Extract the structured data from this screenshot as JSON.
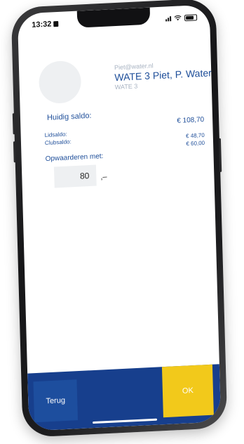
{
  "status_bar": {
    "time": "13:32"
  },
  "user": {
    "email": "Piet@water.nl",
    "name": "WATE 3 Piet, P. Water",
    "code": "WATE 3"
  },
  "saldo": {
    "title": "Huidig saldo:",
    "total": "€ 108,70",
    "lidsaldo_label": "Lidsaldo:",
    "lidsaldo_value": "€ 48,70",
    "clubsaldo_label": "Clubsaldo:",
    "clubsaldo_value": "€ 60,00"
  },
  "topup": {
    "label": "Opwaarderen met:",
    "amount": "80",
    "suffix": ",–"
  },
  "actions": {
    "back_label": "Terug",
    "ok_label": "OK"
  },
  "colors": {
    "brand_blue": "#173f8d",
    "text_blue": "#1f4f9a",
    "accent_yellow": "#f2c91b"
  }
}
